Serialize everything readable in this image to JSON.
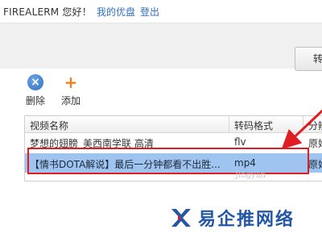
{
  "header": {
    "greeting": "FIREALERM 您好！",
    "my_udisk": "我的优盘",
    "login": "登出"
  },
  "toolbar": {
    "top_right_button": "转",
    "delete_label": "删除",
    "add_label": "添加",
    "delete_icon": "×",
    "add_icon": "+"
  },
  "table": {
    "headers": [
      "视频名称",
      "转码格式",
      "分辨"
    ],
    "rows": [
      {
        "name": "梦想的翅膀_美西南学联 高清",
        "format": "flv",
        "extra": "原始"
      },
      {
        "name": "【情书DOTA解说】最后一分钟都看不出胜...",
        "format": "mp4",
        "extra": "原始"
      }
    ]
  },
  "watermark": "Jingyan",
  "brand": {
    "text": "易企推网络",
    "colors": {
      "primary": "#2357a6",
      "accent": "#e01d22"
    }
  }
}
